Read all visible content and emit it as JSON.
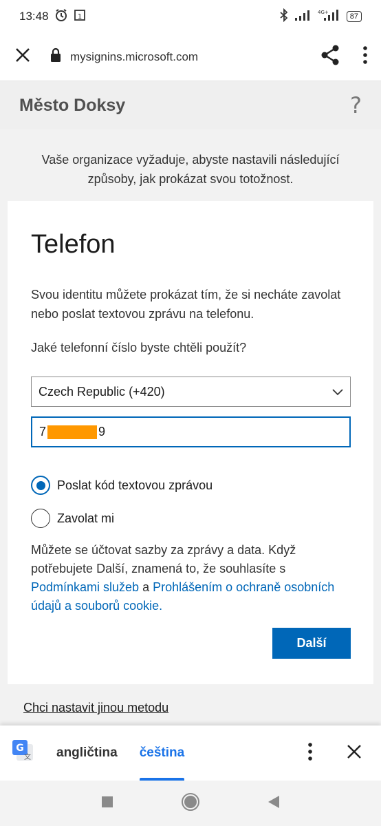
{
  "status_bar": {
    "time": "13:48",
    "battery": "87",
    "network": "4G+"
  },
  "browser": {
    "url": "mysignins.microsoft.com"
  },
  "org": {
    "name": "Město Doksy",
    "help_symbol": "?"
  },
  "intro_text": "Vaše organizace vyžaduje, abyste nastavili následující způsoby, jak prokázat svou totožnost.",
  "card": {
    "title": "Telefon",
    "description": "Svou identitu můžete prokázat tím, že si necháte zavolat nebo poslat textovou zprávu na telefonu.",
    "question": "Jaké telefonní číslo byste chtěli použít?",
    "country_selected": "Czech Republic (+420)",
    "phone_prefix": "7",
    "phone_suffix": "9",
    "options": [
      {
        "label": "Poslat kód textovou zprávou",
        "checked": true
      },
      {
        "label": "Zavolat mi",
        "checked": false
      }
    ],
    "legal_text_1": "Můžete se účtovat sazby za zprávy a data. Když potřebujete Další, znamená to, že souhlasíte s",
    "legal_link_1": "Podmínkami služeb",
    "legal_and": "a",
    "legal_link_2": "Prohlášením o ochraně osobních údajů a souborů cookie.",
    "next_label": "Další"
  },
  "alt_method_label": "Chci nastavit jinou metodu",
  "translate_bar": {
    "languages": [
      "angličtina",
      "čeština"
    ],
    "active_language": "čeština"
  },
  "colors": {
    "accent": "#0067b8",
    "translate_accent": "#1a73e8",
    "redaction": "#ff9800"
  }
}
